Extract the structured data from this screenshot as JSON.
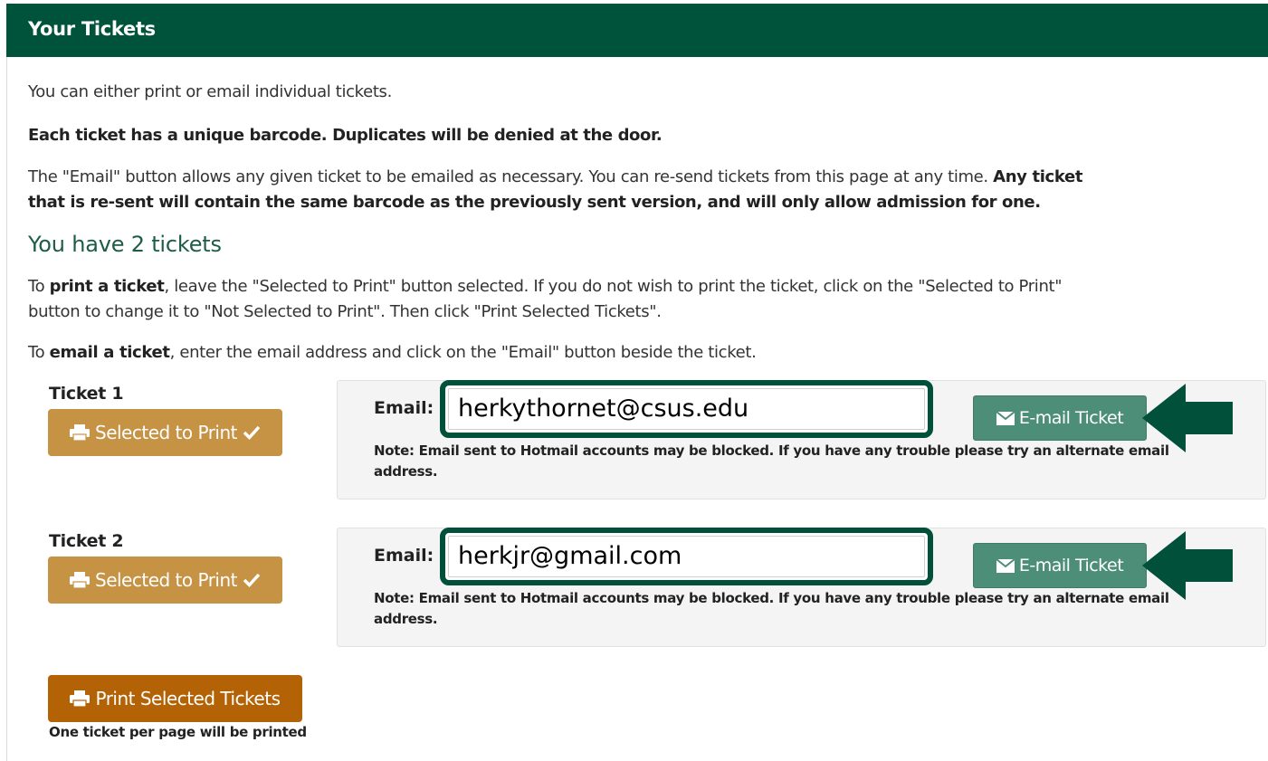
{
  "header": {
    "title": "Your Tickets"
  },
  "intro": {
    "line1": "You can either print or email individual tickets.",
    "line2": "Each ticket has a unique barcode. Duplicates will be denied at the door.",
    "line3_normal": "The \"Email\" button allows any given ticket to be emailed as necessary. You can re-send tickets from this page at any time.",
    "line3_bold_a": "Any ticket",
    "line3_bold_b": "that is re-sent will contain the same barcode as the previously sent version, and will only allow admission for one."
  },
  "tickets_heading": "You have 2 tickets",
  "instructions": {
    "print_pre": "To",
    "print_bold": "print a ticket",
    "print_post": ", leave the \"Selected to Print\" button selected. If you do not wish to print the ticket, click on the \"Selected to Print\"",
    "print_line2": "button to change it to \"Not Selected to Print\". Then click \"Print Selected Tickets\".",
    "email_pre": "To",
    "email_bold": "email a ticket",
    "email_post": ", enter the email address and click on the \"Email\" button beside the ticket."
  },
  "tickets": [
    {
      "label": "Ticket 1",
      "select_label": "Selected to Print",
      "email_label": "Email:",
      "email_value": "herkythornet@csus.edu",
      "email_button": "E-mail Ticket",
      "note": "Note: Email sent to Hotmail accounts may be blocked. If you have any trouble please try an alternate email address."
    },
    {
      "label": "Ticket 2",
      "select_label": "Selected to Print",
      "email_label": "Email:",
      "email_value": "herkjr@gmail.com",
      "email_button": "E-mail Ticket",
      "note": "Note: Email sent to Hotmail accounts may be blocked. If you have any trouble please try an alternate email address."
    }
  ],
  "print_button": "Print Selected Tickets",
  "print_note": "One ticket per page will be printed",
  "icons": {
    "printer": "printer-icon",
    "check": "check-icon",
    "envelope": "envelope-icon",
    "arrow": "arrow-left-icon"
  },
  "colors": {
    "header_bg": "#00533b",
    "select_btn": "#c69244",
    "email_btn": "#4d8e79",
    "print_btn": "#b36205",
    "highlight": "#00503a"
  }
}
